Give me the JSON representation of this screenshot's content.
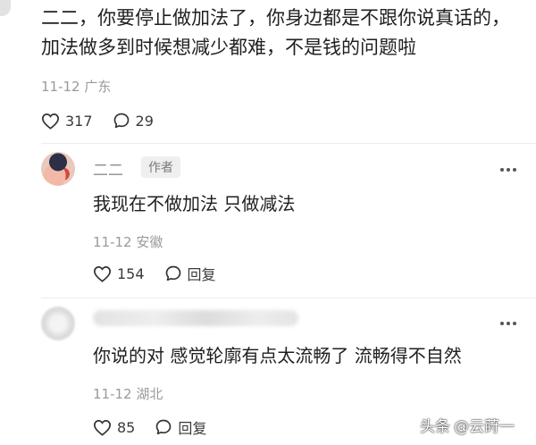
{
  "main_comment": {
    "text": "二二，你要停止做加法了，你身边都是不跟你说真话的，加法做多到时候想减少都难，不是钱的问题啦",
    "date": "11-12",
    "location": "广东",
    "like_count": "317",
    "comment_count": "29"
  },
  "replies": [
    {
      "name": "二二",
      "badge": "作者",
      "text": "我现在不做加法 只做减法",
      "date": "11-12",
      "location": "安徽",
      "like_count": "154",
      "reply_label": "回复"
    },
    {
      "text": "你说的对 感觉轮廓有点太流畅了 流畅得不自然",
      "date": "11-12",
      "location": "湖北",
      "like_count": "85",
      "reply_label": "回复"
    }
  ],
  "watermark": {
    "platform": "头条",
    "handle": "@云莳一"
  },
  "icons": {
    "like": "heart-outline-icon",
    "comment": "speech-bubble-icon",
    "more": "more-dots-icon"
  }
}
